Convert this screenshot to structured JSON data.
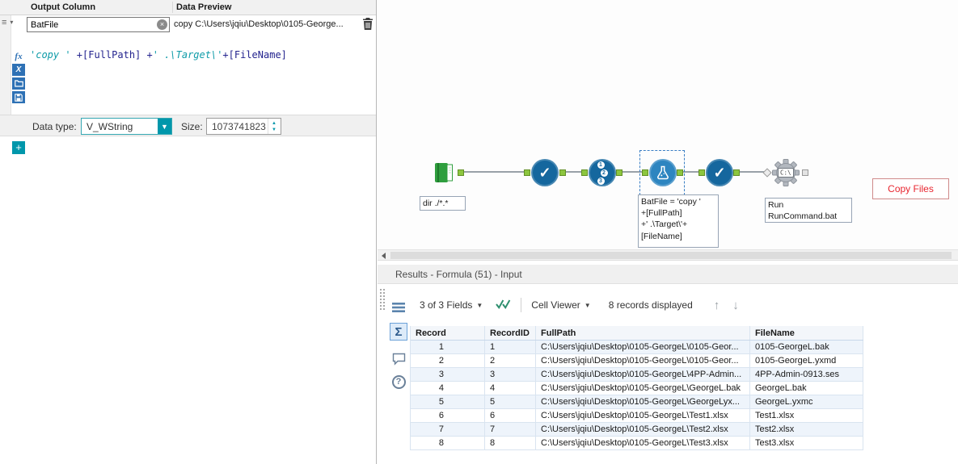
{
  "config": {
    "header": {
      "output_column": "Output Column",
      "data_preview": "Data Preview"
    },
    "row": {
      "name": "BatFile",
      "preview": "copy C:\\Users\\jqiu\\Desktop\\0105-George...",
      "clear_glyph": "×"
    },
    "formula": {
      "seg1": "'copy ' ",
      "seg2": "+[FullPath] +",
      "seg3": "' .\\Target\\'",
      "seg4": "+[FileName]"
    },
    "editor_icons": {
      "fx": "fx",
      "variables": "X"
    },
    "data_type": {
      "label": "Data type:",
      "value": "V_WString"
    },
    "size": {
      "label": "Size:",
      "value": "1073741823"
    },
    "add_button": "+"
  },
  "canvas": {
    "input_annotation": "dir ./*.*",
    "formula_annotation": "BatFile = 'copy '\n+[FullPath]\n+' .\\Target\\'+\n[FileName]",
    "run_annotation": "Run\nRunCommand.bat",
    "comment_text": "Copy Files",
    "run_icon_text": "C:\\",
    "recordid_digits": {
      "d1": "1",
      "d2": "2",
      "d3": "3"
    }
  },
  "results": {
    "title": "Results - Formula (51) - Input",
    "toolbar": {
      "fields": "3 of 3 Fields",
      "cell_viewer": "Cell Viewer",
      "records": "8 records displayed"
    },
    "table": {
      "columns": {
        "record": "Record",
        "recordid": "RecordID",
        "fullpath": "FullPath",
        "filename": "FileName"
      },
      "rows": [
        {
          "record": "1",
          "recordid": "1",
          "fullpath": "C:\\Users\\jqiu\\Desktop\\0105-GeorgeL\\0105-Geor...",
          "filename": "0105-GeorgeL.bak"
        },
        {
          "record": "2",
          "recordid": "2",
          "fullpath": "C:\\Users\\jqiu\\Desktop\\0105-GeorgeL\\0105-Geor...",
          "filename": "0105-GeorgeL.yxmd"
        },
        {
          "record": "3",
          "recordid": "3",
          "fullpath": "C:\\Users\\jqiu\\Desktop\\0105-GeorgeL\\4PP-Admin...",
          "filename": "4PP-Admin-0913.ses"
        },
        {
          "record": "4",
          "recordid": "4",
          "fullpath": "C:\\Users\\jqiu\\Desktop\\0105-GeorgeL\\GeorgeL.bak",
          "filename": "GeorgeL.bak"
        },
        {
          "record": "5",
          "recordid": "5",
          "fullpath": "C:\\Users\\jqiu\\Desktop\\0105-GeorgeL\\GeorgeLyx...",
          "filename": "GeorgeL.yxmc"
        },
        {
          "record": "6",
          "recordid": "6",
          "fullpath": "C:\\Users\\jqiu\\Desktop\\0105-GeorgeL\\Test1.xlsx",
          "filename": "Test1.xlsx"
        },
        {
          "record": "7",
          "recordid": "7",
          "fullpath": "C:\\Users\\jqiu\\Desktop\\0105-GeorgeL\\Test2.xlsx",
          "filename": "Test2.xlsx"
        },
        {
          "record": "8",
          "recordid": "8",
          "fullpath": "C:\\Users\\jqiu\\Desktop\\0105-GeorgeL\\Test3.xlsx",
          "filename": "Test3.xlsx"
        }
      ]
    }
  }
}
